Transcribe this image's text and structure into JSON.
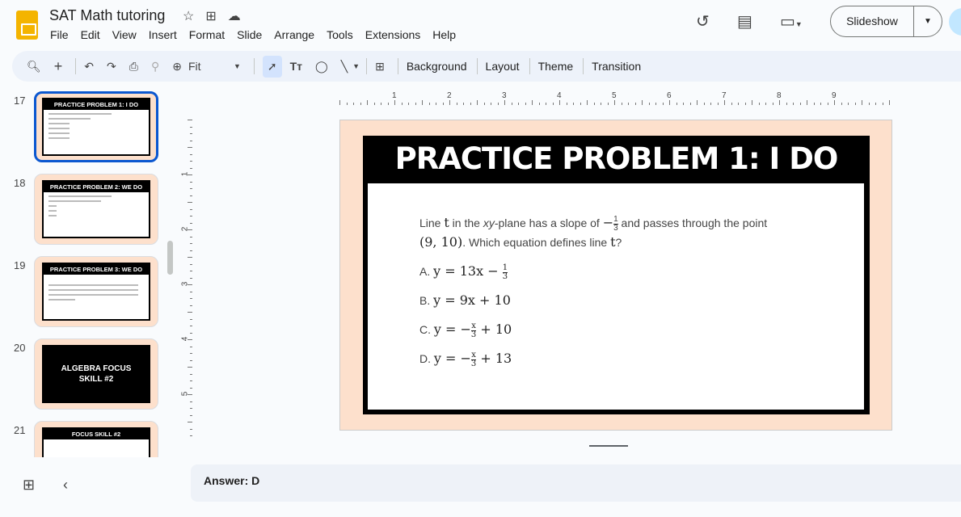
{
  "app": {
    "title": "SAT Math tutoring",
    "menu": [
      "File",
      "Edit",
      "View",
      "Insert",
      "Format",
      "Slide",
      "Arrange",
      "Tools",
      "Extensions",
      "Help"
    ],
    "slideshow_label": "Slideshow"
  },
  "toolbar": {
    "zoom": "Fit",
    "buttons": [
      "Background",
      "Layout",
      "Theme",
      "Transition"
    ]
  },
  "filmstrip": [
    {
      "num": "17",
      "title": "PRACTICE PROBLEM 1: I DO"
    },
    {
      "num": "18",
      "title": "PRACTICE PROBLEM 2: WE DO"
    },
    {
      "num": "19",
      "title": "PRACTICE PROBLEM 3: WE DO"
    },
    {
      "num": "20",
      "title": "ALGEBRA FOCUS SKILL #2"
    },
    {
      "num": "21",
      "title": "FOCUS SKILL #2"
    }
  ],
  "ruler": {
    "h": [
      "1",
      "2",
      "3",
      "4",
      "5",
      "6",
      "7",
      "8",
      "9"
    ],
    "v": [
      "1",
      "2",
      "3",
      "4",
      "5"
    ]
  },
  "slide": {
    "title": "PRACTICE PROBLEM 1: I DO",
    "q1": "Line ",
    "var": "t",
    "q2": " in the ",
    "xy": "xy",
    "q3": "-plane has a slope of ",
    "slope_sign": "−",
    "slope_n": "1",
    "slope_d": "3",
    "q4": " and passes through the point",
    "point": "(9, 10)",
    "q5": ". Which equation defines line ",
    "q6": "?",
    "options": [
      {
        "label": "A.",
        "eq": "y = 13x − ",
        "fn": "1",
        "fd": "3",
        "tail": ""
      },
      {
        "label": "B.",
        "eq": "y = 9x + 10",
        "fn": "",
        "fd": "",
        "tail": ""
      },
      {
        "label": "C.",
        "eq": "y = −",
        "fn": "x",
        "fd": "3",
        "tail": " + 10"
      },
      {
        "label": "D.",
        "eq": "y = −",
        "fn": "x",
        "fd": "3",
        "tail": " + 13"
      }
    ]
  },
  "notes": "Answer: D"
}
